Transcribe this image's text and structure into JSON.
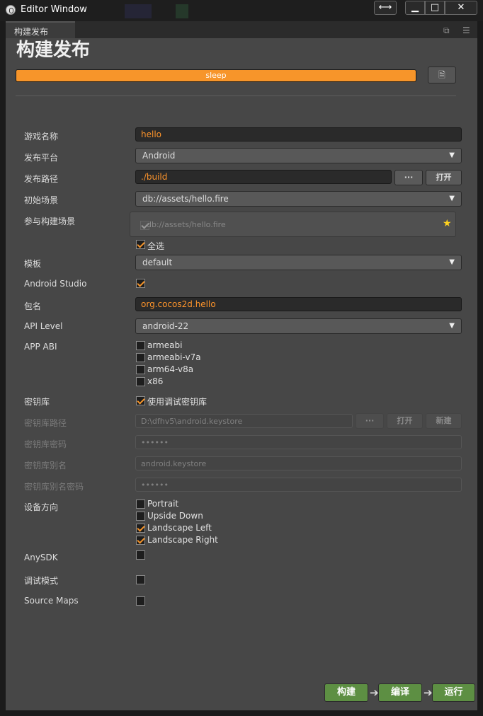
{
  "window": {
    "title": "Editor Window",
    "move_glyph": "⟷",
    "min_glyph": "▁",
    "max_glyph": "□",
    "close_glyph": "✕"
  },
  "tab": {
    "label": "构建发布"
  },
  "panel": {
    "title": "构建发布"
  },
  "build_progress": {
    "label": "sleep",
    "percent": 100,
    "color": "#f7952a"
  },
  "form": {
    "game_name": {
      "label": "游戏名称",
      "value": "hello"
    },
    "platform": {
      "label": "发布平台",
      "value": "Android"
    },
    "build_path": {
      "label": "发布路径",
      "value": "./build",
      "browse": "···",
      "open": "打开"
    },
    "start_scene": {
      "label": "初始场景",
      "value": "db://assets/hello.fire"
    },
    "scenes": {
      "label": "参与构建场景",
      "item": "db://assets/hello.fire",
      "select_all": "全选"
    },
    "template": {
      "label": "模板",
      "value": "default"
    },
    "android_studio": {
      "label": "Android Studio",
      "checked": true
    },
    "package": {
      "label": "包名",
      "value": "org.cocos2d.hello"
    },
    "api_level": {
      "label": "API Level",
      "value": "android-22"
    },
    "app_abi": {
      "label": "APP ABI",
      "options": [
        "armeabi",
        "armeabi-v7a",
        "arm64-v8a",
        "x86"
      ],
      "checked": [
        false,
        false,
        false,
        false
      ]
    },
    "keystore": {
      "label": "密钥库",
      "use_debug": "使用调试密钥库",
      "use_debug_checked": true
    },
    "keystore_path": {
      "label": "密钥库路径",
      "value": "D:\\dfhv5\\android.keystore",
      "browse": "···",
      "open": "打开",
      "new": "新建"
    },
    "keystore_password": {
      "label": "密钥库密码",
      "value": "••••••"
    },
    "keystore_alias": {
      "label": "密钥库别名",
      "value": "android.keystore"
    },
    "alias_password": {
      "label": "密钥库别名密码",
      "value": "••••••"
    },
    "orientation": {
      "label": "设备方向",
      "options": [
        "Portrait",
        "Upside Down",
        "Landscape Left",
        "Landscape Right"
      ],
      "checked": [
        false,
        false,
        true,
        true
      ]
    },
    "anysdk": {
      "label": "AnySDK",
      "checked": false
    },
    "debug": {
      "label": "调试模式",
      "checked": false
    },
    "source_maps": {
      "label": "Source Maps",
      "checked": false
    }
  },
  "actions": {
    "build": "构建",
    "compile": "编译",
    "run": "运行",
    "arrow": "➔"
  },
  "colors": {
    "accent": "#f7952a",
    "action_green": "#5d8f43",
    "panel_bg": "#474747"
  }
}
